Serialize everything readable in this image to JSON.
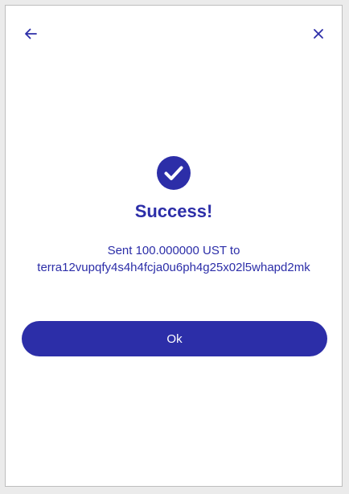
{
  "header": {
    "back_icon": "arrow-left-icon",
    "close_icon": "close-icon"
  },
  "result": {
    "icon": "check-circle-icon",
    "title": "Success!",
    "message_line1": "Sent 100.000000 UST to",
    "message_line2": "terra12vupqfy4s4h4fcja0u6ph4g25x02l5whapd2mk"
  },
  "actions": {
    "ok_label": "Ok"
  },
  "colors": {
    "accent": "#2c2ea8",
    "background": "#ffffff"
  }
}
